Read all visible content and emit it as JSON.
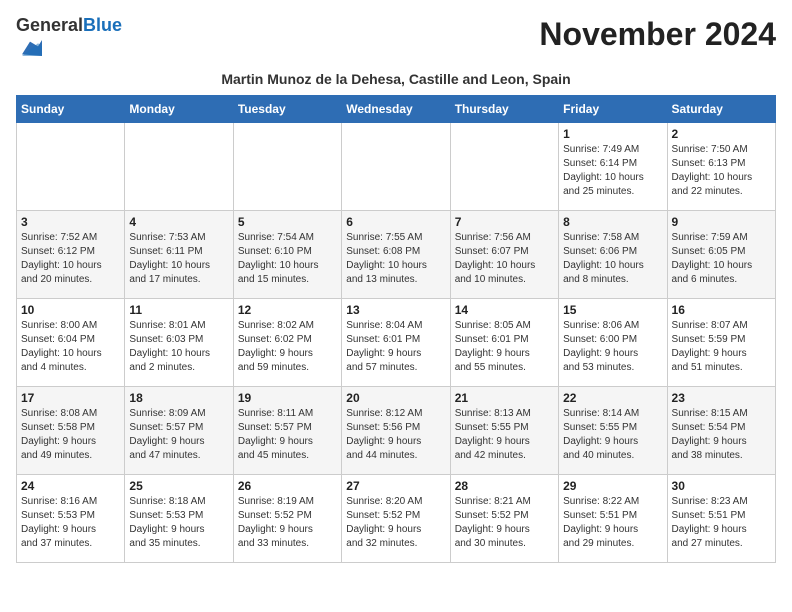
{
  "logo": {
    "general": "General",
    "blue": "Blue"
  },
  "header": {
    "month": "November 2024",
    "location": "Martin Munoz de la Dehesa, Castille and Leon, Spain"
  },
  "weekdays": [
    "Sunday",
    "Monday",
    "Tuesday",
    "Wednesday",
    "Thursday",
    "Friday",
    "Saturday"
  ],
  "weeks": [
    [
      {
        "day": "",
        "info": ""
      },
      {
        "day": "",
        "info": ""
      },
      {
        "day": "",
        "info": ""
      },
      {
        "day": "",
        "info": ""
      },
      {
        "day": "",
        "info": ""
      },
      {
        "day": "1",
        "info": "Sunrise: 7:49 AM\nSunset: 6:14 PM\nDaylight: 10 hours\nand 25 minutes."
      },
      {
        "day": "2",
        "info": "Sunrise: 7:50 AM\nSunset: 6:13 PM\nDaylight: 10 hours\nand 22 minutes."
      }
    ],
    [
      {
        "day": "3",
        "info": "Sunrise: 7:52 AM\nSunset: 6:12 PM\nDaylight: 10 hours\nand 20 minutes."
      },
      {
        "day": "4",
        "info": "Sunrise: 7:53 AM\nSunset: 6:11 PM\nDaylight: 10 hours\nand 17 minutes."
      },
      {
        "day": "5",
        "info": "Sunrise: 7:54 AM\nSunset: 6:10 PM\nDaylight: 10 hours\nand 15 minutes."
      },
      {
        "day": "6",
        "info": "Sunrise: 7:55 AM\nSunset: 6:08 PM\nDaylight: 10 hours\nand 13 minutes."
      },
      {
        "day": "7",
        "info": "Sunrise: 7:56 AM\nSunset: 6:07 PM\nDaylight: 10 hours\nand 10 minutes."
      },
      {
        "day": "8",
        "info": "Sunrise: 7:58 AM\nSunset: 6:06 PM\nDaylight: 10 hours\nand 8 minutes."
      },
      {
        "day": "9",
        "info": "Sunrise: 7:59 AM\nSunset: 6:05 PM\nDaylight: 10 hours\nand 6 minutes."
      }
    ],
    [
      {
        "day": "10",
        "info": "Sunrise: 8:00 AM\nSunset: 6:04 PM\nDaylight: 10 hours\nand 4 minutes."
      },
      {
        "day": "11",
        "info": "Sunrise: 8:01 AM\nSunset: 6:03 PM\nDaylight: 10 hours\nand 2 minutes."
      },
      {
        "day": "12",
        "info": "Sunrise: 8:02 AM\nSunset: 6:02 PM\nDaylight: 9 hours\nand 59 minutes."
      },
      {
        "day": "13",
        "info": "Sunrise: 8:04 AM\nSunset: 6:01 PM\nDaylight: 9 hours\nand 57 minutes."
      },
      {
        "day": "14",
        "info": "Sunrise: 8:05 AM\nSunset: 6:01 PM\nDaylight: 9 hours\nand 55 minutes."
      },
      {
        "day": "15",
        "info": "Sunrise: 8:06 AM\nSunset: 6:00 PM\nDaylight: 9 hours\nand 53 minutes."
      },
      {
        "day": "16",
        "info": "Sunrise: 8:07 AM\nSunset: 5:59 PM\nDaylight: 9 hours\nand 51 minutes."
      }
    ],
    [
      {
        "day": "17",
        "info": "Sunrise: 8:08 AM\nSunset: 5:58 PM\nDaylight: 9 hours\nand 49 minutes."
      },
      {
        "day": "18",
        "info": "Sunrise: 8:09 AM\nSunset: 5:57 PM\nDaylight: 9 hours\nand 47 minutes."
      },
      {
        "day": "19",
        "info": "Sunrise: 8:11 AM\nSunset: 5:57 PM\nDaylight: 9 hours\nand 45 minutes."
      },
      {
        "day": "20",
        "info": "Sunrise: 8:12 AM\nSunset: 5:56 PM\nDaylight: 9 hours\nand 44 minutes."
      },
      {
        "day": "21",
        "info": "Sunrise: 8:13 AM\nSunset: 5:55 PM\nDaylight: 9 hours\nand 42 minutes."
      },
      {
        "day": "22",
        "info": "Sunrise: 8:14 AM\nSunset: 5:55 PM\nDaylight: 9 hours\nand 40 minutes."
      },
      {
        "day": "23",
        "info": "Sunrise: 8:15 AM\nSunset: 5:54 PM\nDaylight: 9 hours\nand 38 minutes."
      }
    ],
    [
      {
        "day": "24",
        "info": "Sunrise: 8:16 AM\nSunset: 5:53 PM\nDaylight: 9 hours\nand 37 minutes."
      },
      {
        "day": "25",
        "info": "Sunrise: 8:18 AM\nSunset: 5:53 PM\nDaylight: 9 hours\nand 35 minutes."
      },
      {
        "day": "26",
        "info": "Sunrise: 8:19 AM\nSunset: 5:52 PM\nDaylight: 9 hours\nand 33 minutes."
      },
      {
        "day": "27",
        "info": "Sunrise: 8:20 AM\nSunset: 5:52 PM\nDaylight: 9 hours\nand 32 minutes."
      },
      {
        "day": "28",
        "info": "Sunrise: 8:21 AM\nSunset: 5:52 PM\nDaylight: 9 hours\nand 30 minutes."
      },
      {
        "day": "29",
        "info": "Sunrise: 8:22 AM\nSunset: 5:51 PM\nDaylight: 9 hours\nand 29 minutes."
      },
      {
        "day": "30",
        "info": "Sunrise: 8:23 AM\nSunset: 5:51 PM\nDaylight: 9 hours\nand 27 minutes."
      }
    ]
  ]
}
